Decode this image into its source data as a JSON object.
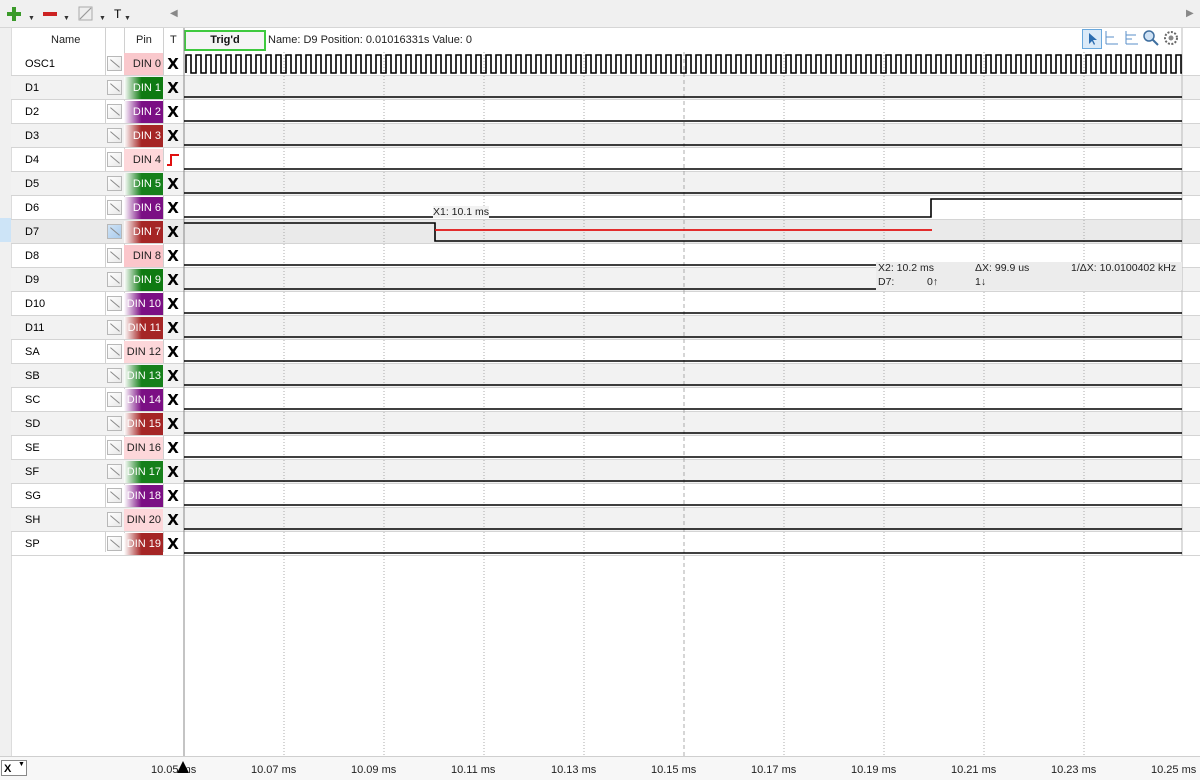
{
  "toolbar": {
    "add_icon": "plus-icon",
    "remove_icon": "minus-icon",
    "edit_icon": "pen-icon",
    "text_label": "T"
  },
  "columns": {
    "name": "Name",
    "pin": "Pin",
    "trigger": "T"
  },
  "status": {
    "trigger_state": "Trig'd",
    "info": "Name: D9  Position: 0.01016331s  Value: 0"
  },
  "channels": [
    {
      "name": "OSC1",
      "pin": "DIN  0",
      "pin_color": "#f9c8cc",
      "pin_text": "#222",
      "trigger": "X"
    },
    {
      "name": "D1",
      "pin": "DIN  1",
      "pin_color": "#0f7a12",
      "pin_text": "#fff",
      "trigger": "X"
    },
    {
      "name": "D2",
      "pin": "DIN  2",
      "pin_color": "#7b0f84",
      "pin_text": "#fff",
      "trigger": "X"
    },
    {
      "name": "D3",
      "pin": "DIN  3",
      "pin_color": "#a52525",
      "pin_text": "#fff",
      "trigger": "X"
    },
    {
      "name": "D4",
      "pin": "DIN  4",
      "pin_color": "#fdd7da",
      "pin_text": "#222",
      "trigger": "rise"
    },
    {
      "name": "D5",
      "pin": "DIN  5",
      "pin_color": "#16801b",
      "pin_text": "#fff",
      "trigger": "X"
    },
    {
      "name": "D6",
      "pin": "DIN  6",
      "pin_color": "#7b0f84",
      "pin_text": "#fff",
      "trigger": "X"
    },
    {
      "name": "D7",
      "pin": "DIN  7",
      "pin_color": "#a52525",
      "pin_text": "#fff",
      "trigger": "X"
    },
    {
      "name": "D8",
      "pin": "DIN  8",
      "pin_color": "#fbc6cb",
      "pin_text": "#222",
      "trigger": "X"
    },
    {
      "name": "D9",
      "pin": "DIN  9",
      "pin_color": "#0f7a12",
      "pin_text": "#fff",
      "trigger": "X"
    },
    {
      "name": "D10",
      "pin": "DIN 10",
      "pin_color": "#7b0f84",
      "pin_text": "#fff",
      "trigger": "X"
    },
    {
      "name": "D11",
      "pin": "DIN 11",
      "pin_color": "#a52525",
      "pin_text": "#fff",
      "trigger": "X"
    },
    {
      "name": "SA",
      "pin": "DIN 12",
      "pin_color": "#fdd7da",
      "pin_text": "#222",
      "trigger": "X"
    },
    {
      "name": "SB",
      "pin": "DIN 13",
      "pin_color": "#16801b",
      "pin_text": "#fff",
      "trigger": "X"
    },
    {
      "name": "SC",
      "pin": "DIN 14",
      "pin_color": "#7b0f84",
      "pin_text": "#fff",
      "trigger": "X"
    },
    {
      "name": "SD",
      "pin": "DIN 15",
      "pin_color": "#a52525",
      "pin_text": "#fff",
      "trigger": "X"
    },
    {
      "name": "SE",
      "pin": "DIN 16",
      "pin_color": "#fdd7da",
      "pin_text": "#222",
      "trigger": "X"
    },
    {
      "name": "SF",
      "pin": "DIN 17",
      "pin_color": "#16801b",
      "pin_text": "#fff",
      "trigger": "X"
    },
    {
      "name": "SG",
      "pin": "DIN 18",
      "pin_color": "#7b0f84",
      "pin_text": "#fff",
      "trigger": "X"
    },
    {
      "name": "SH",
      "pin": "DIN 20",
      "pin_color": "#fdd7da",
      "pin_text": "#222",
      "trigger": "X"
    },
    {
      "name": "SP",
      "pin": "DIN 19",
      "pin_color": "#a52525",
      "pin_text": "#fff",
      "trigger": "X"
    }
  ],
  "cursors": {
    "x1_label": "X1: 10.1 ms",
    "x2_label": "X2: 10.2 ms",
    "dx_label": "ΔX: 99.9 us",
    "inv_dx_label": "1/ΔX: 10.0100402 kHz",
    "channel_label": "D7:",
    "at_x1": "0↑",
    "at_x2": "1↓"
  },
  "time_axis": {
    "ticks": [
      "10.05 ms",
      "10.07 ms",
      "10.09 ms",
      "10.11 ms",
      "10.13 ms",
      "10.15 ms",
      "10.17 ms",
      "10.19 ms",
      "10.21 ms",
      "10.23 ms",
      "10.25 ms"
    ]
  },
  "bottom": {
    "zoom_value": "X"
  },
  "colors": {
    "trigger_box": "#3ec93e",
    "cursor_line": "#e01010",
    "selected_row": "#cde4f7"
  }
}
